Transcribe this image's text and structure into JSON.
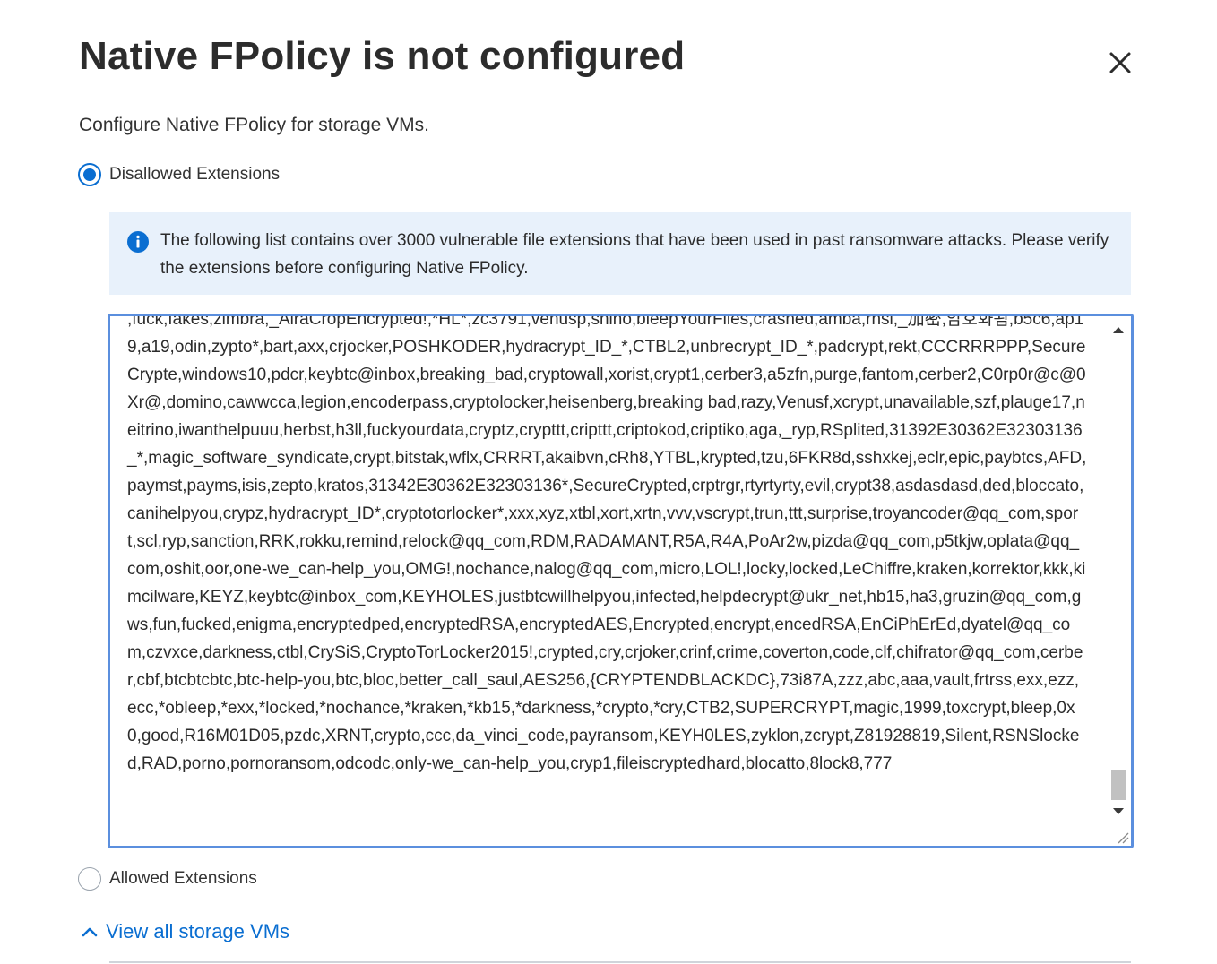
{
  "dialog": {
    "title": "Native FPolicy is not configured",
    "subtitle": "Configure Native FPolicy for storage VMs.",
    "close_icon": "close-icon"
  },
  "options": {
    "disallowed_label": "Disallowed Extensions",
    "disallowed_checked": true,
    "allowed_label": "Allowed Extensions",
    "allowed_checked": false
  },
  "info": {
    "icon": "info-icon",
    "text": "The following list contains over 3000 vulnerable file extensions that have been used in past ransomware attacks. Please verify the extensions before configuring Native FPolicy."
  },
  "extensions": {
    "value": ",fuck,fakes,zimbra,_AiraCropEncrypted!,*HL*,zc3791,venusp,shino,bleepYourFiles,crashed,amba,rnsl,_加密,암호화됨,b5c6,ap19,a19,odin,zypto*,bart,axx,crjocker,POSHKODER,hydracrypt_ID_*,CTBL2,unbrecrypt_ID_*,padcrypt,rekt,CCCRRRPPP,SecureCrypte,windows10,pdcr,keybtc@inbox,breaking_bad,cryptowall,xorist,crypt1,cerber3,a5zfn,purge,fantom,cerber2,C0rp0r@c@0Xr@,domino,cawwcca,legion,encoderpass,cryptolocker,heisenberg,breaking bad,razy,Venusf,xcrypt,unavailable,szf,plauge17,neitrino,iwanthelpuuu,herbst,h3ll,fuckyourdata,cryptz,crypttt,cripttt,criptokod,criptiko,aga,_ryp,RSplited,31392E30362E32303136_*,magic_software_syndicate,crypt,bitstak,wflx,CRRRT,akaibvn,cRh8,YTBL,krypted,tzu,6FKR8d,sshxkej,eclr,epic,paybtcs,AFD,paymst,payms,isis,zepto,kratos,31342E30362E32303136*,SecureCrypted,crptrgr,rtyrtyrty,evil,crypt38,asdasdasd,ded,bloccato,canihelpyou,crypz,hydracrypt_ID*,cryptotorlocker*,xxx,xyz,xtbl,xort,xrtn,vvv,vscrypt,trun,ttt,surprise,troyancoder@qq_com,sport,scl,ryp,sanction,RRK,rokku,remind,relock@qq_com,RDM,RADAMANT,R5A,R4A,PoAr2w,pizda@qq_com,p5tkjw,oplata@qq_com,oshit,oor,one-we_can-help_you,OMG!,nochance,nalog@qq_com,micro,LOL!,locky,locked,LeChiffre,kraken,korrektor,kkk,kimcilware,KEYZ,keybtc@inbox_com,KEYHOLES,justbtcwillhelpyou,infected,helpdecrypt@ukr_net,hb15,ha3,gruzin@qq_com,gws,fun,fucked,enigma,encryptedped,encryptedRSA,encryptedAES,Encrypted,encrypt,encedRSA,EnCiPhErEd,dyatel@qq_com,czvxce,darkness,ctbl,CrySiS,CryptoTorLocker2015!,crypted,cry,crjoker,crinf,crime,coverton,code,clf,chifrator@qq_com,cerber,cbf,btcbtcbtc,btc-help-you,btc,bloc,better_call_saul,AES256,{CRYPTENDBLACKDC},73i87A,zzz,abc,aaa,vault,frtrss,exx,ezz,ecc,*obleep,*exx,*locked,*nochance,*kraken,*kb15,*darkness,*crypto,*cry,CTB2,SUPERCRYPT,magic,1999,toxcrypt,bleep,0x0,good,R16M01D05,pzdc,XRNT,crypto,ccc,da_vinci_code,payransom,KEYH0LES,zyklon,zcrypt,Z81928819,Silent,RSNSlocked,RAD,porno,pornoransom,odcodc,only-we_can-help_you,cryp1,fileiscryptedhard,blocatto,8lock8,777"
  },
  "footer": {
    "view_all_label": "View all storage VMs",
    "chevron_icon": "chevron-up-icon"
  }
}
